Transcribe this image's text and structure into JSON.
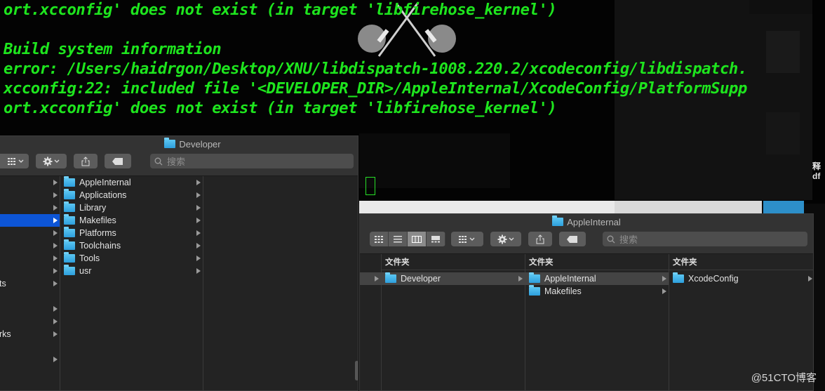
{
  "terminal": {
    "lines": [
      "ort.xcconfig' does not exist (in target 'libfirehose_kernel')",
      "Build system information",
      "error: /Users/haidrgon/Desktop/XNU/libdispatch-1008.220.2/xcodeconfig/libdispatch.",
      "xcconfig:22: included file '<DEVELOPER_DIR>/AppleInternal/XcodeConfig/PlatformSupp",
      "ort.xcconfig' does not exist (in target 'libfirehose_kernel')"
    ],
    "text_color": "#1ee51e",
    "side_chars": [
      "释",
      "df"
    ]
  },
  "finder_left": {
    "title": "Developer",
    "search_placeholder": "搜索",
    "sidebar_partial_labels": [
      "ts",
      "rks"
    ],
    "items": [
      "AppleInternal",
      "Applications",
      "Library",
      "Makefiles",
      "Platforms",
      "Toolchains",
      "Tools",
      "usr"
    ]
  },
  "finder_right": {
    "title": "AppleInternal",
    "search_placeholder": "搜索",
    "columns": [
      {
        "header": "文件夹",
        "items": [
          "Developer"
        ]
      },
      {
        "header": "文件夹",
        "items": [
          "AppleInternal",
          "Makefiles"
        ]
      },
      {
        "header": "文件夹",
        "items": [
          "XcodeConfig"
        ]
      }
    ]
  },
  "watermark": "@51CTO博客",
  "colors": {
    "selection_blue": "#0d55d6",
    "folder_blue": "#2d9fdd",
    "selection_grey": "#444444"
  }
}
